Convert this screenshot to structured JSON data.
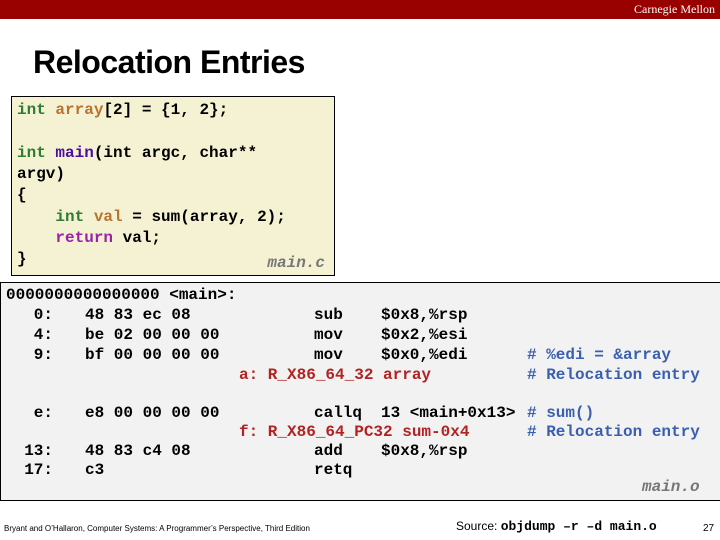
{
  "header": {
    "brand": "Carnegie Mellon"
  },
  "slide": {
    "title": "Relocation Entries"
  },
  "source_code": {
    "filename": "main.c",
    "lines": [
      [
        {
          "t": "int",
          "c": "type"
        },
        {
          "t": " ",
          "c": "plain"
        },
        {
          "t": "array",
          "c": "var"
        },
        {
          "t": "[2] = {1, 2};",
          "c": "plain"
        }
      ],
      [],
      [
        {
          "t": "int",
          "c": "type"
        },
        {
          "t": " ",
          "c": "plain"
        },
        {
          "t": "main",
          "c": "fn"
        },
        {
          "t": "(int argc, char**",
          "c": "plain"
        }
      ],
      [
        {
          "t": "argv)",
          "c": "plain"
        }
      ],
      [
        {
          "t": "{",
          "c": "plain"
        }
      ],
      [
        {
          "t": "    ",
          "c": "plain"
        },
        {
          "t": "int",
          "c": "type"
        },
        {
          "t": " ",
          "c": "plain"
        },
        {
          "t": "val",
          "c": "var"
        },
        {
          "t": " = sum(array, 2);",
          "c": "plain"
        }
      ],
      [
        {
          "t": "    ",
          "c": "plain"
        },
        {
          "t": "return",
          "c": "ret"
        },
        {
          "t": " val;",
          "c": "plain"
        }
      ],
      [
        {
          "t": "}",
          "c": "plain"
        }
      ]
    ]
  },
  "disassembly": {
    "filename": "main.o",
    "header": "0000000000000000 <main>:",
    "rows": [
      {
        "addr": "0:",
        "bytes": "48 83 ec 08",
        "op": "sub",
        "args": "$0x8,%rsp",
        "comment": ""
      },
      {
        "addr": "4:",
        "bytes": "be 02 00 00 00",
        "op": "mov",
        "args": "$0x2,%esi",
        "comment": ""
      },
      {
        "addr": "9:",
        "bytes": "bf 00 00 00 00",
        "op": "mov",
        "args": "$0x0,%edi",
        "comment": "# %edi = &array"
      },
      {
        "reloc": "a: R_X86_64_32 array",
        "comment": "# Relocation entry"
      },
      {
        "addr": "e:",
        "bytes": "e8 00 00 00 00",
        "op": "callq",
        "args": "13 <main+0x13>",
        "comment": "# sum()"
      },
      {
        "reloc": "f: R_X86_64_PC32 sum-0x4",
        "comment": "# Relocation entry"
      },
      {
        "addr": "13:",
        "bytes": "48 83 c4 08",
        "op": "add",
        "args": "$0x8,%rsp",
        "comment": ""
      },
      {
        "addr": "17:",
        "bytes": "c3",
        "op": "retq",
        "args": "",
        "comment": ""
      }
    ]
  },
  "footer": {
    "citation": "Bryant and O’Hallaron, Computer Systems: A Programmer’s Perspective, Third Edition",
    "source_label": "Source: ",
    "source_cmd": "objdump –r –d main.o",
    "page_number": "27"
  },
  "colors": {
    "header_bar": "#990000",
    "code_bg": "#f5f1d3",
    "disasm_bg": "#f2f2f2",
    "relocation": "#b22222",
    "comment": "#3a5fb0"
  }
}
